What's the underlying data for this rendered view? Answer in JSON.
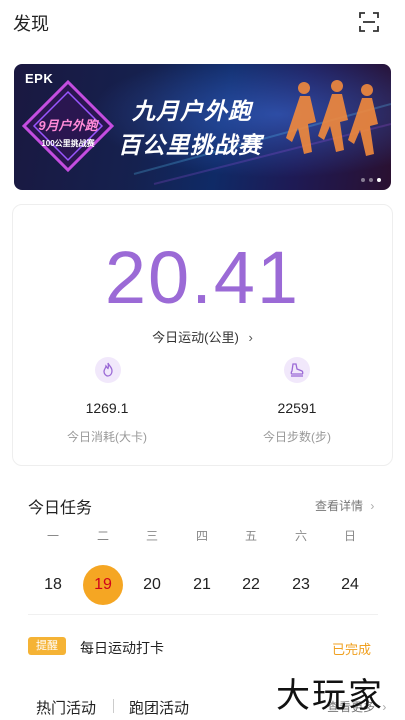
{
  "header": {
    "title": "发现",
    "scan_icon": "scan-icon"
  },
  "banner": {
    "brand": "EPK",
    "line1": "九月户外跑",
    "line2": "百公里挑战赛",
    "emblem_text": "9月户外跑",
    "emblem_sub": "100公里挑战赛",
    "slide_count": 3,
    "active_slide": 3
  },
  "stats": {
    "distance_value": "20.41",
    "distance_label": "今日运动(公里)",
    "calories_value": "1269.1",
    "calories_label": "今日消耗(大卡)",
    "calories_icon": "flame-icon",
    "steps_value": "22591",
    "steps_label": "今日步数(步)",
    "steps_icon": "shoe-icon",
    "accent": "#9b6ad6"
  },
  "tasks": {
    "title": "今日任务",
    "more": "查看详情",
    "weekdays": [
      "一",
      "二",
      "三",
      "四",
      "五",
      "六",
      "日"
    ],
    "dates": [
      "18",
      "19",
      "20",
      "21",
      "22",
      "23",
      "24"
    ],
    "selected_date": "19",
    "reminder_badge": "提醒",
    "reminder_text": "每日运动打卡",
    "reminder_status": "已完成"
  },
  "bottom_tabs": {
    "tab1": "热门活动",
    "tab2": "跑团活动",
    "more": "查看更多"
  },
  "watermark": "大玩家",
  "colors": {
    "highlight": "#f5a623",
    "badge": "#f5b335",
    "done": "#f0a020"
  }
}
